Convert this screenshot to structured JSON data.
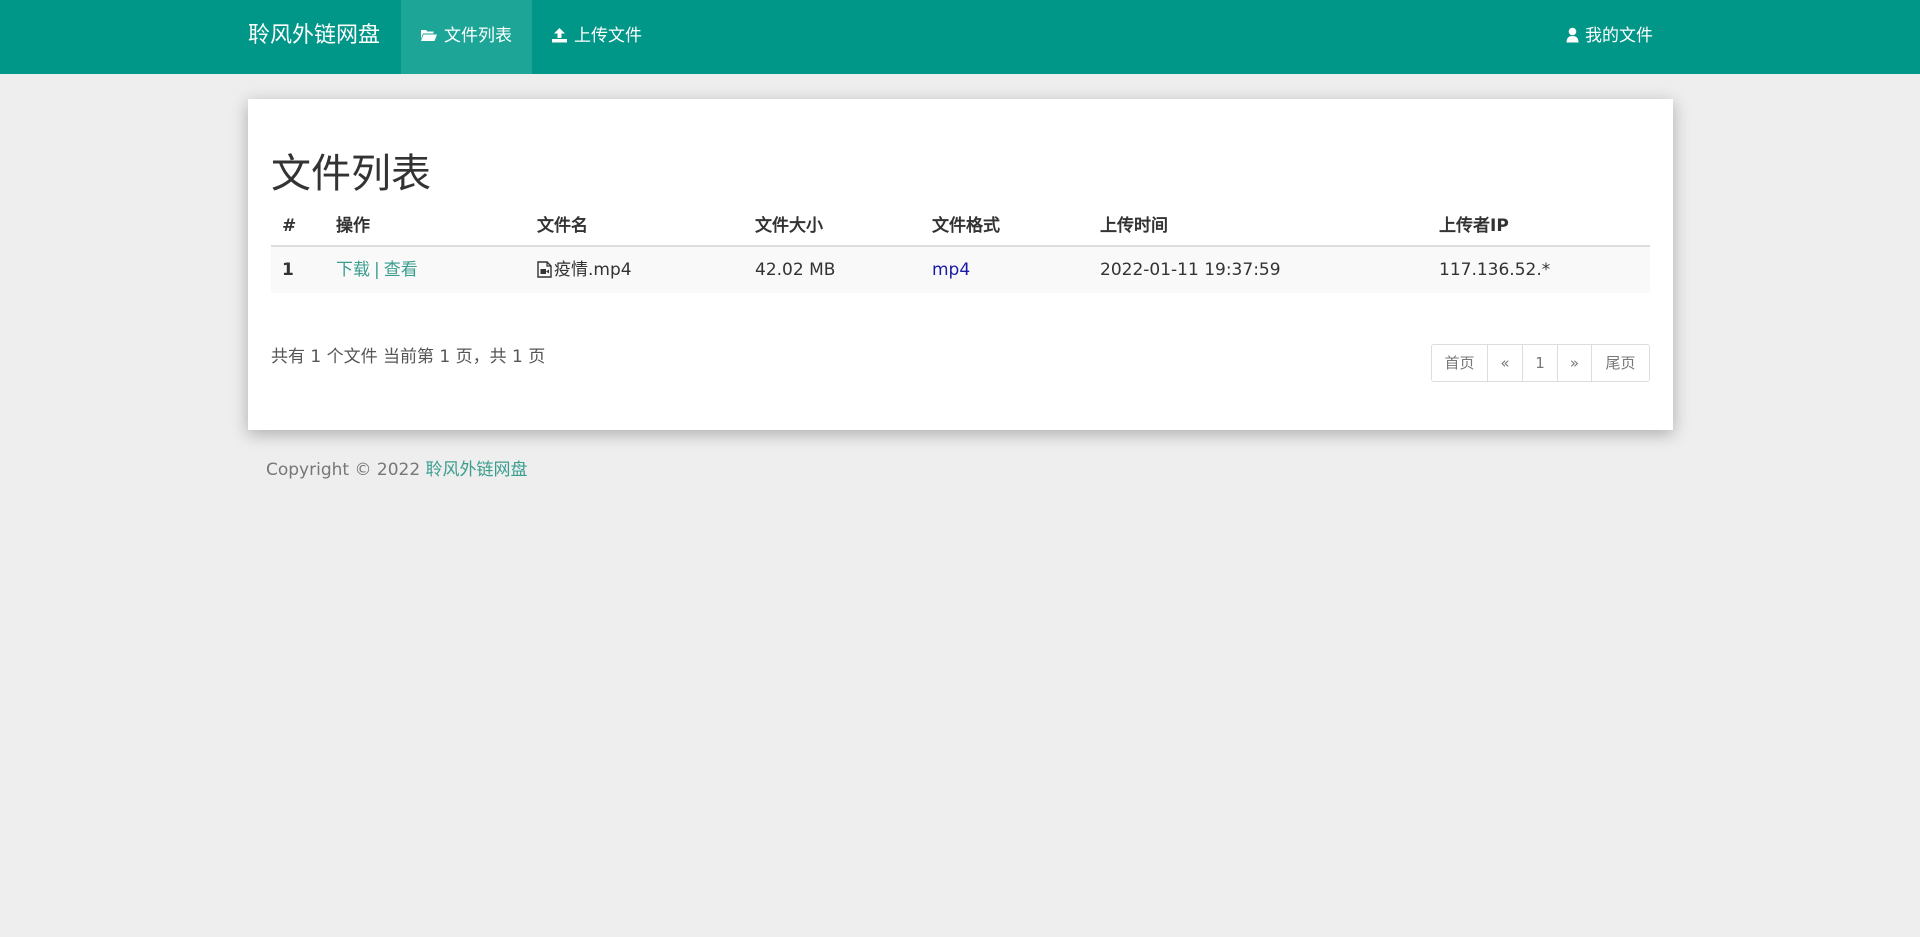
{
  "nav": {
    "brand": "聆风外链网盘",
    "items": [
      {
        "label": "文件列表",
        "icon": "folder-open-icon",
        "active": true
      },
      {
        "label": "上传文件",
        "icon": "upload-icon",
        "active": false
      }
    ],
    "right": {
      "label": "我的文件",
      "icon": "user-icon"
    }
  },
  "colors": {
    "nav_bg": "#009688",
    "nav_active_bg": "#1da698",
    "link_green": "#3a9e8f",
    "link_blue": "#1a1aa6",
    "page_bg": "#eeeeee"
  },
  "main": {
    "title": "文件列表",
    "table": {
      "headers": [
        "#",
        "操作",
        "文件名",
        "文件大小",
        "文件格式",
        "上传时间",
        "上传者IP"
      ],
      "rows": [
        {
          "index": "1",
          "action_download": "下载",
          "action_separator": "|",
          "action_view": "查看",
          "file_icon": "video-file-icon",
          "filename": "疫情.mp4",
          "size": "42.02 MB",
          "format": "mp4",
          "uploaded_at": "2022-01-11 19:37:59",
          "uploader_ip": "117.136.52.*"
        }
      ]
    },
    "summary": "共有 1 个文件  当前第 1 页，共 1 页",
    "pagination": {
      "first": "首页",
      "prev": "«",
      "current": "1",
      "next": "»",
      "last": "尾页"
    }
  },
  "footer": {
    "copyright": "Copyright © 2022 ",
    "link": "聆风外链网盘"
  }
}
